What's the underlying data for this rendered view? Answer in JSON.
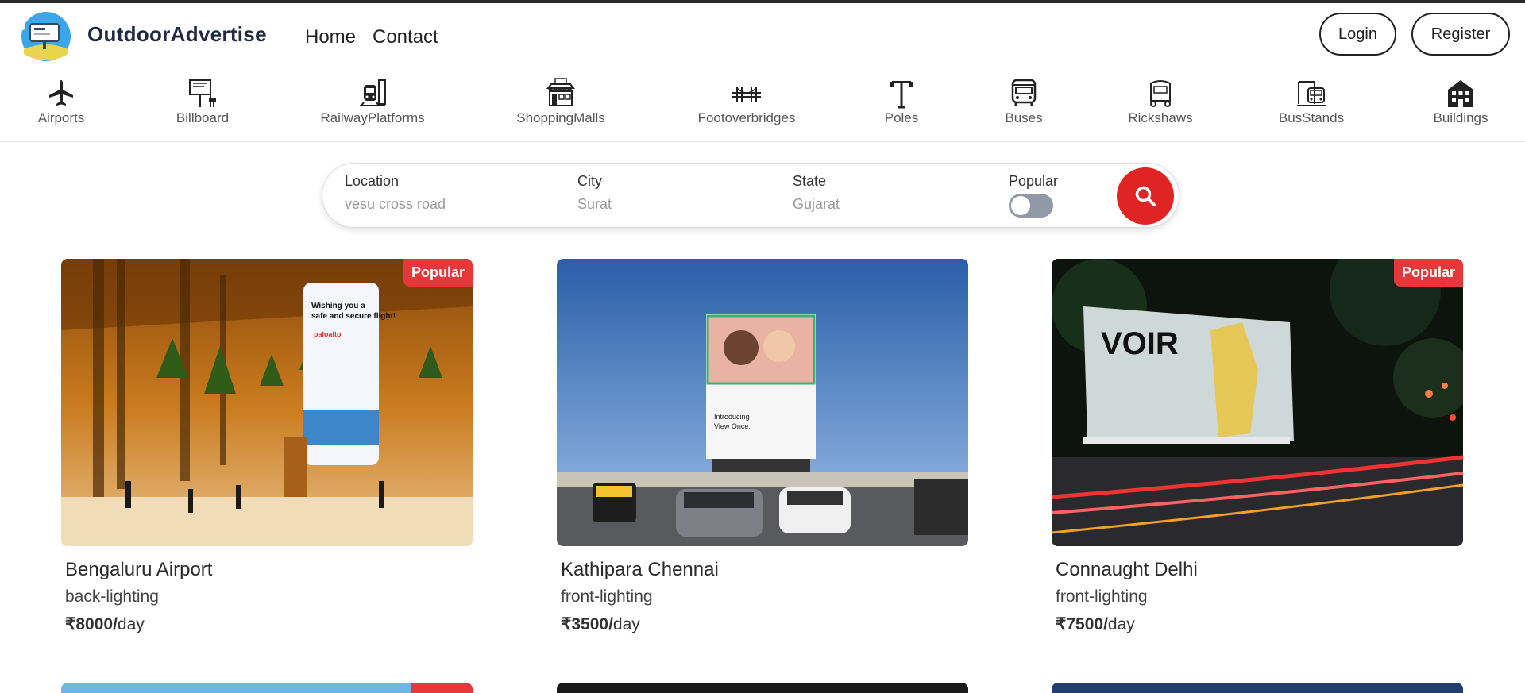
{
  "brand": {
    "name": "OutdoorAdvertise"
  },
  "nav": {
    "home": "Home",
    "contact": "Contact"
  },
  "auth": {
    "login": "Login",
    "register": "Register"
  },
  "categories": [
    {
      "label": "Airports",
      "icon": "airplane-icon"
    },
    {
      "label": "Billboard",
      "icon": "billboard-icon"
    },
    {
      "label": "RailwayPlatforms",
      "icon": "train-icon"
    },
    {
      "label": "ShoppingMalls",
      "icon": "mall-icon"
    },
    {
      "label": "Footoverbridges",
      "icon": "bridge-icon"
    },
    {
      "label": "Poles",
      "icon": "pole-icon"
    },
    {
      "label": "Buses",
      "icon": "bus-icon"
    },
    {
      "label": "Rickshaws",
      "icon": "rickshaw-icon"
    },
    {
      "label": "BusStands",
      "icon": "bus-stand-icon"
    },
    {
      "label": "Buildings",
      "icon": "building-icon"
    }
  ],
  "search": {
    "location": {
      "label": "Location",
      "placeholder": "vesu cross road"
    },
    "city": {
      "label": "City",
      "placeholder": "Surat"
    },
    "state": {
      "label": "State",
      "placeholder": "Gujarat"
    },
    "popular": {
      "label": "Popular",
      "on": false
    },
    "button_icon": "search-icon"
  },
  "listings": [
    {
      "title": "Bengaluru Airport",
      "lighting": "back-lighting",
      "price": "₹8000/",
      "unit": "day",
      "badge": "Popular",
      "popular": true
    },
    {
      "title": "Kathipara Chennai",
      "lighting": "front-lighting",
      "price": "₹3500/",
      "unit": "day",
      "badge": "",
      "popular": false
    },
    {
      "title": "Connaught Delhi",
      "lighting": "front-lighting",
      "price": "₹7500/",
      "unit": "day",
      "badge": "Popular",
      "popular": true
    }
  ],
  "colors": {
    "accent": "#e02424",
    "badge": "#e5383b",
    "brand_text": "#1f2a44"
  }
}
